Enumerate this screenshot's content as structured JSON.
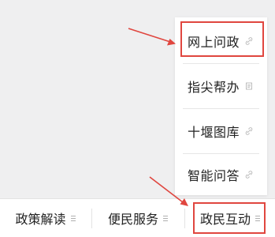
{
  "submenu": {
    "items": [
      {
        "label": "网上问政",
        "icon": "link-icon"
      },
      {
        "label": "指尖帮办",
        "icon": "document-icon"
      },
      {
        "label": "十堰图库",
        "icon": "link-icon"
      },
      {
        "label": "智能问答",
        "icon": "link-icon"
      }
    ]
  },
  "bottom_nav": {
    "tabs": [
      {
        "label": "政策解读",
        "icon": "menu-icon"
      },
      {
        "label": "便民服务",
        "icon": "menu-icon"
      },
      {
        "label": "政民互动",
        "icon": "menu-icon"
      }
    ]
  },
  "annotation": {
    "color": "#e0463f"
  }
}
